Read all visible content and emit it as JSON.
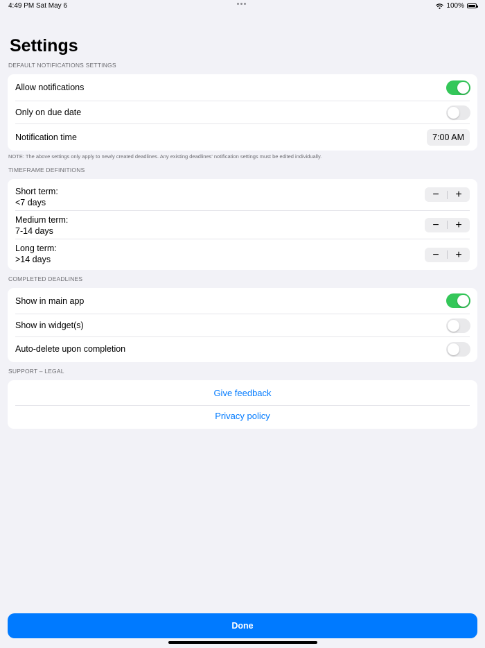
{
  "status_bar": {
    "time": "4:49 PM",
    "date": "Sat May 6",
    "battery_percent": "100%"
  },
  "title": "Settings",
  "notifications": {
    "header": "DEFAULT NOTIFICATIONS SETTINGS",
    "allow_label": "Allow notifications",
    "allow_on": true,
    "due_date_label": "Only on due date",
    "due_date_on": false,
    "time_label": "Notification time",
    "time_value": "7:00 AM",
    "note": "NOTE: The above settings only apply to newly created deadlines. Any existing deadlines' notification settings must be edited individually."
  },
  "timeframes": {
    "header": "TIMEFRAME DEFINITIONS",
    "minus": "−",
    "plus": "+",
    "items": [
      {
        "name": "Short term:",
        "value": "<7 days"
      },
      {
        "name": "Medium term:",
        "value": "7-14 days"
      },
      {
        "name": "Long term:",
        "value": ">14 days"
      }
    ]
  },
  "completed": {
    "header": "COMPLETED DEADLINES",
    "main_app_label": "Show in main app",
    "main_app_on": true,
    "widgets_label": "Show in widget(s)",
    "widgets_on": false,
    "autodelete_label": "Auto-delete upon completion",
    "autodelete_on": false
  },
  "support": {
    "header": "SUPPORT – LEGAL",
    "feedback": "Give feedback",
    "privacy": "Privacy policy"
  },
  "done_label": "Done",
  "colors": {
    "accent": "#007aff",
    "toggle_on": "#34c759",
    "background": "#f2f2f7"
  }
}
